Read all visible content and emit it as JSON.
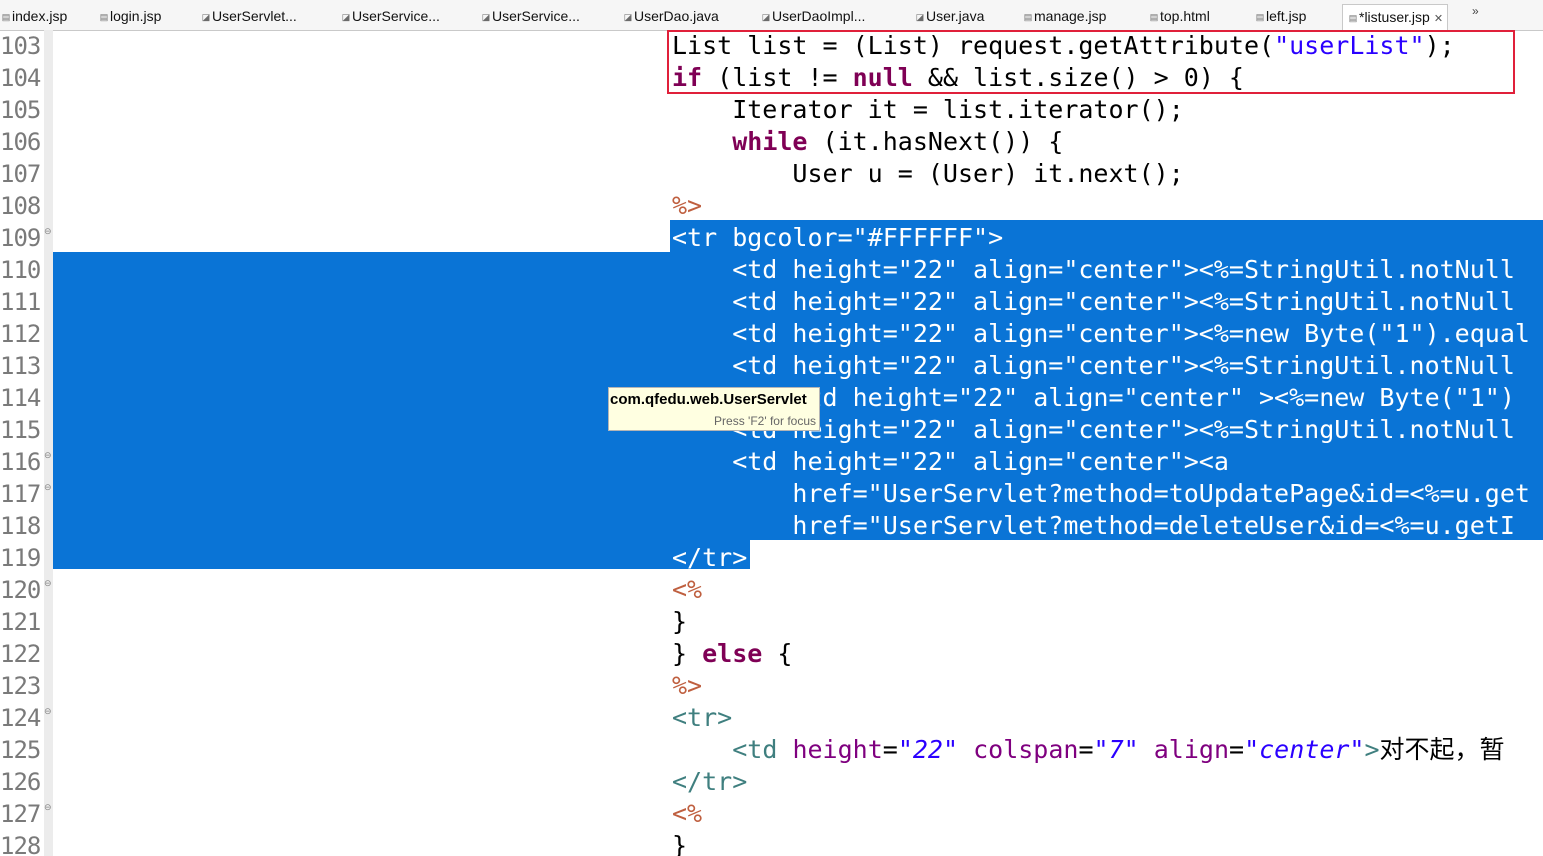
{
  "tabs": [
    {
      "label": "index.jsp",
      "icon": "jsp-file-icon"
    },
    {
      "label": "login.jsp",
      "icon": "jsp-file-icon"
    },
    {
      "label": "UserServlet...",
      "icon": "java-file-icon"
    },
    {
      "label": "UserService...",
      "icon": "java-file-icon"
    },
    {
      "label": "UserService...",
      "icon": "java-file-icon"
    },
    {
      "label": "UserDao.java",
      "icon": "java-file-icon"
    },
    {
      "label": "UserDaoImpl...",
      "icon": "java-file-icon"
    },
    {
      "label": "User.java",
      "icon": "java-file-icon"
    },
    {
      "label": "manage.jsp",
      "icon": "jsp-file-icon"
    },
    {
      "label": "top.html",
      "icon": "html-file-icon"
    },
    {
      "label": "left.jsp",
      "icon": "jsp-file-icon"
    },
    {
      "label": "*listuser.jsp",
      "icon": "jsp-file-icon",
      "active": true,
      "close": "✕"
    }
  ],
  "tab_overflow": "»",
  "editor": {
    "lines": [
      {
        "num": "103",
        "code": "List list = (List) request.getAttribute(\"userList\");"
      },
      {
        "num": "104",
        "code": "if (list != null && list.size() > 0) {"
      },
      {
        "num": "105",
        "code": "    Iterator it = list.iterator();"
      },
      {
        "num": "106",
        "code": "    while (it.hasNext()) {"
      },
      {
        "num": "107",
        "code": "        User u = (User) it.next();"
      },
      {
        "num": "108",
        "code": "%>"
      },
      {
        "num": "109",
        "code": "<tr bgcolor=\"#FFFFFF\">"
      },
      {
        "num": "110",
        "code": "    <td height=\"22\" align=\"center\"><%=StringUtil.notNull"
      },
      {
        "num": "111",
        "code": "    <td height=\"22\" align=\"center\"><%=StringUtil.notNull"
      },
      {
        "num": "112",
        "code": "    <td height=\"22\" align=\"center\"><%=new Byte(\"1\").equal"
      },
      {
        "num": "113",
        "code": "    <td height=\"22\" align=\"center\"><%=StringUtil.notNull"
      },
      {
        "num": "114",
        "code": "    <%--<td height=\"22\" align=\"center\" ><%=new Byte(\"1\")"
      },
      {
        "num": "115",
        "code": "    <td height=\"22\" align=\"center\"><%=StringUtil.notNull"
      },
      {
        "num": "116",
        "code": "    <td height=\"22\" align=\"center\"><a"
      },
      {
        "num": "117",
        "code": "        href=\"UserServlet?method=toUpdatePage&id=<%=u.get"
      },
      {
        "num": "118",
        "code": "        href=\"UserServlet?method=deleteUser&id=<%=u.getI"
      },
      {
        "num": "119",
        "code": "</tr>"
      },
      {
        "num": "120",
        "code": "<%"
      },
      {
        "num": "121",
        "code": "}"
      },
      {
        "num": "122",
        "code": "} else {"
      },
      {
        "num": "123",
        "code": "%>"
      },
      {
        "num": "124",
        "code": "<tr>"
      },
      {
        "num": "125",
        "code": "    <td height=\"22\" colspan=\"7\" align=\"center\">对不起，暂"
      },
      {
        "num": "126",
        "code": "</tr>"
      },
      {
        "num": "127",
        "code": "<%"
      },
      {
        "num": "128",
        "code": "}"
      }
    ]
  },
  "tooltip": {
    "title": "com.qfedu.web.UserServlet",
    "hint": "Press 'F2' for focus"
  },
  "colors": {
    "selection": "#0a74d6",
    "highlight_box": "#e0203a",
    "keyword": "#7f0055",
    "string": "#2a00ff",
    "tag": "#3f7f7f",
    "attribute": "#7f007f",
    "jsp_delimiter": "#bf5f3f"
  }
}
